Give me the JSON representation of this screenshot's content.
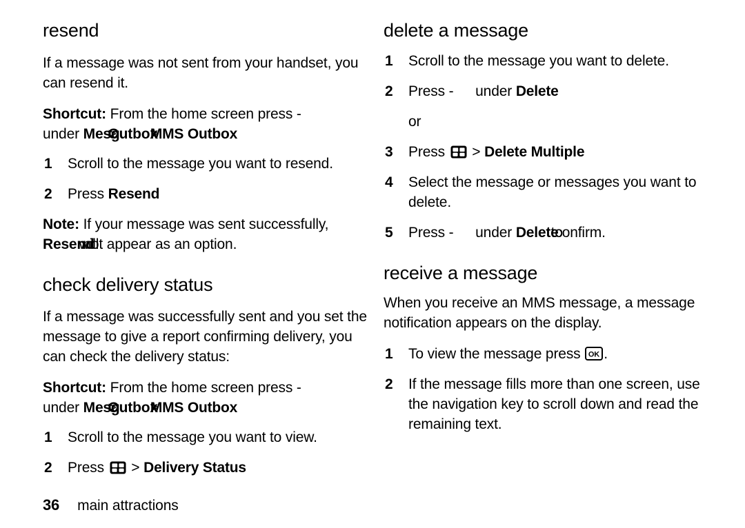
{
  "document": {
    "page_number": "36",
    "footer_title": "main attractions"
  },
  "icons": {
    "menu_icon_label": "menu-key-icon",
    "ok_icon_label": "ok-key-icon",
    "ok_icon_text": "OK",
    "softkey_dash": "-"
  },
  "left_column": {
    "sections": [
      {
        "heading": "resend",
        "intro": "If a message was not sent from your handset, you can resend it.",
        "shortcut_label": "Shortcut:",
        "shortcut_text": " From the home screen press -",
        "shortcut_under_prefix": "under ",
        "shortcut_path_a": "Mesg",
        "shortcut_sep_a": ">",
        "shortcut_path_b": "Outbox",
        "shortcut_sep_b": ">",
        "shortcut_path_c": "MMS Outbox",
        "steps": [
          {
            "num": "1",
            "text": "Scroll to the message you want to resend."
          },
          {
            "num": "2",
            "press_label": "Press ",
            "option": "Resend"
          }
        ],
        "note_label": "Note:",
        "note_text": " If your message was sent successfully,",
        "note_option": "Resend",
        "note_overlap": "will",
        "note_tail": " not appear as an option."
      },
      {
        "heading": "check delivery status",
        "intro": "If a message was successfully sent and you set the message to give a report confirming delivery, you can check the delivery status:",
        "shortcut_label": "Shortcut:",
        "shortcut_text": " From the home screen press -",
        "shortcut_under_prefix": "under ",
        "shortcut_path_a": "Mesg",
        "shortcut_sep_a": ">",
        "shortcut_path_b": "Outbox",
        "shortcut_sep_b": ">",
        "shortcut_path_c": "MMS Outbox",
        "steps": [
          {
            "num": "1",
            "text": "Scroll to the message you want to view."
          },
          {
            "num": "2",
            "press_label": "Press ",
            "separator": " > ",
            "option": "Delivery Status"
          }
        ]
      }
    ]
  },
  "right_column": {
    "sections": [
      {
        "heading": "delete a message",
        "steps": [
          {
            "num": "1",
            "text": "Scroll to the message you want to delete."
          },
          {
            "num": "2",
            "press_label": "Press ",
            "under_label": " under ",
            "option": "Delete"
          },
          {
            "num": "",
            "text": "or"
          },
          {
            "num": "3",
            "press_label": "Press ",
            "separator": " > ",
            "option": "Delete Multiple"
          },
          {
            "num": "4",
            "text": "Select the message or messages you want to delete."
          },
          {
            "num": "5",
            "press_label": "Press ",
            "under_label": " under ",
            "option": "Delete",
            "overlap": "to",
            "tail": " confirm."
          }
        ]
      },
      {
        "heading": "receive a message",
        "intro": "When you receive an MMS message, a message notification appears on the display.",
        "steps": [
          {
            "num": "1",
            "pre": "To view the message press ",
            "post": "."
          },
          {
            "num": "2",
            "text": "If the message fills more than one screen, use the navigation key to scroll down and read the remaining text."
          }
        ]
      }
    ]
  }
}
